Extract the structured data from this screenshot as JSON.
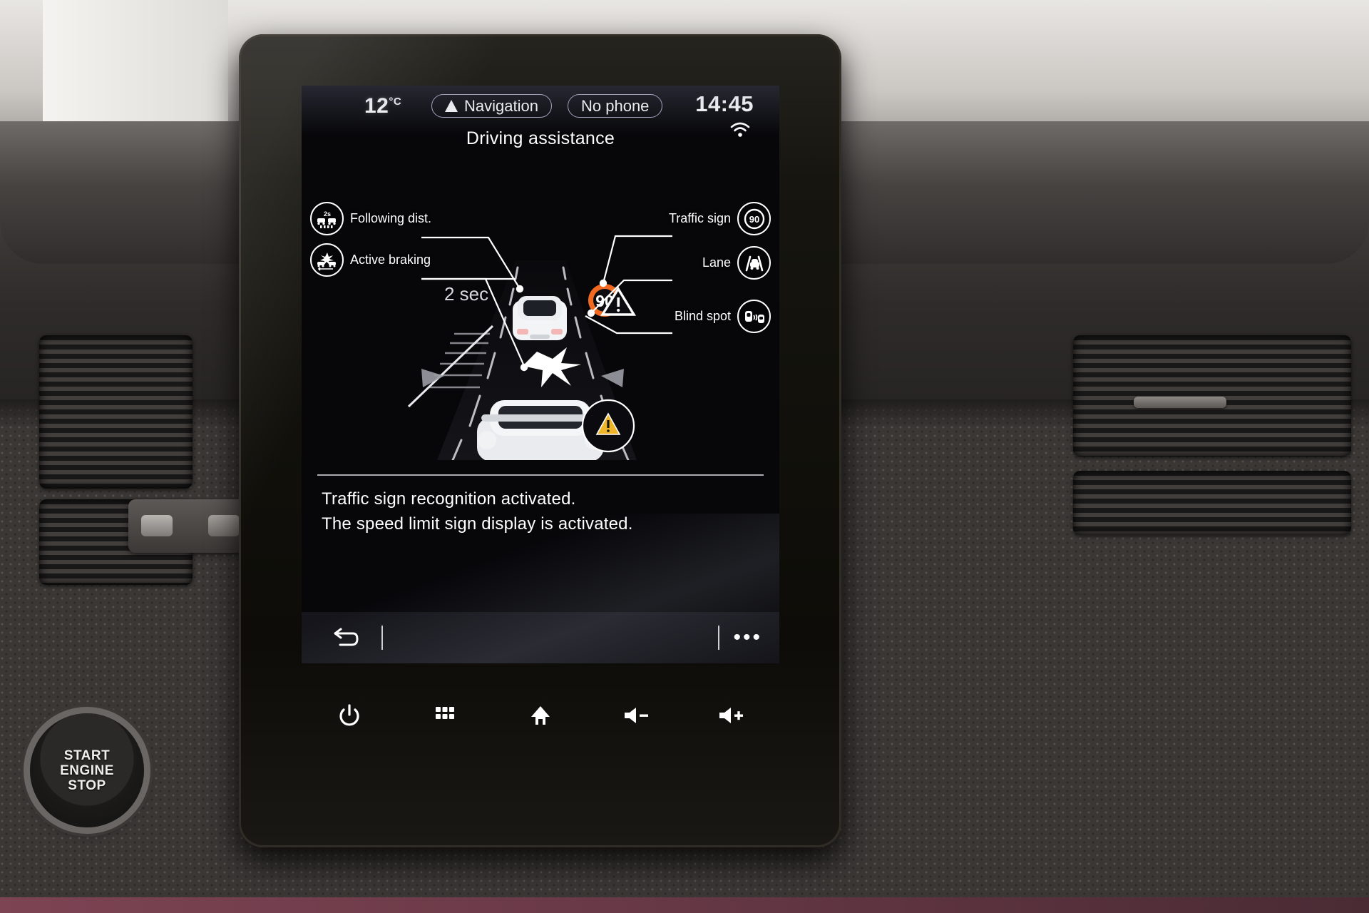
{
  "vehicle": {
    "start_button_line1": "START",
    "start_button_line2": "ENGINE",
    "start_button_line3": "STOP"
  },
  "statusbar": {
    "temperature": "12",
    "temperature_unit": "°C",
    "navigation_label": "Navigation",
    "navigation_icon": "navigation-arrow-icon",
    "phone_label": "No phone",
    "clock": "14:45",
    "connectivity_icon": "wifi-icon"
  },
  "screen": {
    "title": "Driving assistance"
  },
  "diagram": {
    "following_distance_value": "2 sec",
    "speed_sign_value": "90",
    "speed_sign_color": "#f26a21",
    "warning_icon": "warning-triangle-icon",
    "blindspot_alert_icon": "blind-spot-warning-icon",
    "callouts": [
      {
        "label": "Following dist.",
        "icon": "following-distance-icon",
        "icon_value": "2s",
        "side": "left"
      },
      {
        "label": "Active braking",
        "icon": "active-braking-icon",
        "side": "left"
      },
      {
        "label": "Traffic sign",
        "icon": "traffic-sign-icon",
        "icon_value": "90",
        "side": "right"
      },
      {
        "label": "Lane",
        "icon": "lane-keeping-icon",
        "side": "right"
      },
      {
        "label": "Blind spot",
        "icon": "blind-spot-icon",
        "side": "right"
      }
    ]
  },
  "status_message": {
    "line1": "Traffic sign recognition activated.",
    "line2": "The speed limit sign display is activated."
  },
  "toolbar": {
    "back_icon": "back-arrow-icon",
    "more_icon": "more-options-icon",
    "more_label": "•••"
  },
  "hardware_bar": {
    "buttons": [
      {
        "name": "power-button",
        "icon": "power-icon"
      },
      {
        "name": "apps-button",
        "icon": "apps-grid-icon"
      },
      {
        "name": "home-button",
        "icon": "home-icon"
      },
      {
        "name": "volume-down-button",
        "icon": "volume-down-icon"
      },
      {
        "name": "volume-up-button",
        "icon": "volume-up-icon"
      }
    ]
  },
  "colors": {
    "screen_background": "#07070a",
    "accent_orange": "#f26a21",
    "text_primary": "#ffffff",
    "pill_border": "#a9acc4"
  }
}
